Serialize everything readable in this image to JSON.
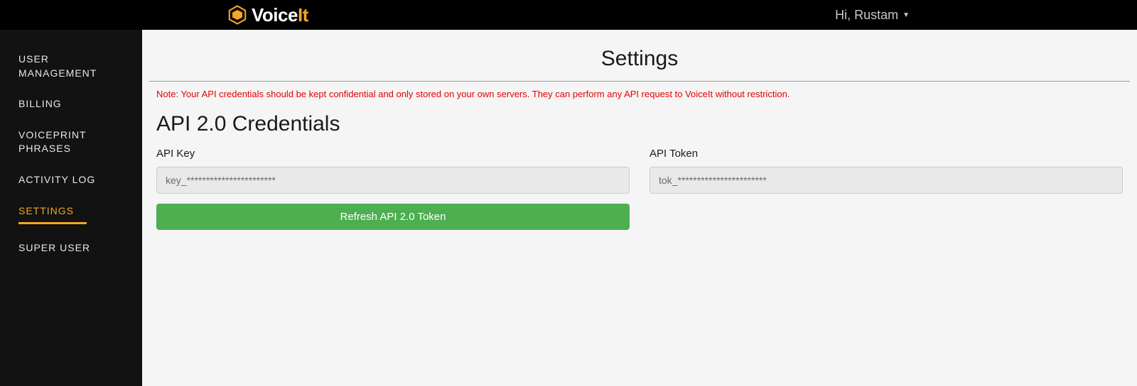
{
  "header": {
    "brand_prefix": "Voice",
    "brand_suffix": "It",
    "user_greeting": "Hi, Rustam"
  },
  "sidebar": {
    "items": [
      {
        "label": "USER MANAGEMENT",
        "active": false
      },
      {
        "label": "BILLING",
        "active": false
      },
      {
        "label": "VOICEPRINT PHRASES",
        "active": false
      },
      {
        "label": "ACTIVITY LOG",
        "active": false
      },
      {
        "label": "SETTINGS",
        "active": true
      },
      {
        "label": "SUPER USER",
        "active": false
      }
    ]
  },
  "main": {
    "title": "Settings",
    "note": "Note: Your API credentials should be kept confidential and only stored on your own servers. They can perform any API request to VoiceIt without restriction.",
    "section_title": "API 2.0 Credentials",
    "api_key": {
      "label": "API Key",
      "value": "key_***********************"
    },
    "api_token": {
      "label": "API Token",
      "value": "tok_***********************"
    },
    "refresh_button": "Refresh API 2.0 Token"
  }
}
